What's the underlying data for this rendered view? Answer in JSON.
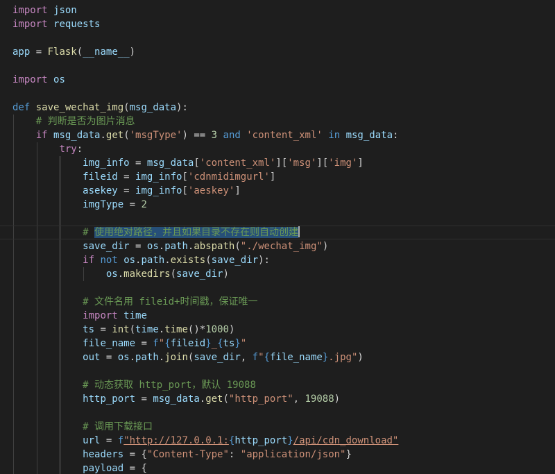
{
  "editor": {
    "lines": [
      {
        "tokens": [
          [
            "k",
            "import"
          ],
          [
            "p",
            " "
          ],
          [
            "v",
            "json"
          ]
        ]
      },
      {
        "tokens": [
          [
            "k",
            "import"
          ],
          [
            "p",
            " "
          ],
          [
            "v",
            "requests"
          ]
        ]
      },
      {
        "tokens": []
      },
      {
        "tokens": [
          [
            "v",
            "app"
          ],
          [
            "p",
            " = "
          ],
          [
            "f",
            "Flask"
          ],
          [
            "p",
            "("
          ],
          [
            "v",
            "__name__"
          ],
          [
            "p",
            ")"
          ]
        ]
      },
      {
        "tokens": []
      },
      {
        "tokens": [
          [
            "k",
            "import"
          ],
          [
            "p",
            " "
          ],
          [
            "v",
            "os"
          ]
        ]
      },
      {
        "tokens": []
      },
      {
        "tokens": [
          [
            "d",
            "def"
          ],
          [
            "p",
            " "
          ],
          [
            "f",
            "save_wechat_img"
          ],
          [
            "p",
            "("
          ],
          [
            "v",
            "msg_data"
          ],
          [
            "p",
            "):"
          ]
        ]
      },
      {
        "tokens": [
          [
            "p",
            "    "
          ],
          [
            "c",
            "# 判断是否为图片消息"
          ]
        ]
      },
      {
        "tokens": [
          [
            "p",
            "    "
          ],
          [
            "k",
            "if"
          ],
          [
            "p",
            " "
          ],
          [
            "v",
            "msg_data"
          ],
          [
            "p",
            "."
          ],
          [
            "f",
            "get"
          ],
          [
            "p",
            "("
          ],
          [
            "s",
            "'msgType'"
          ],
          [
            "p",
            ") == "
          ],
          [
            "n",
            "3"
          ],
          [
            "p",
            " "
          ],
          [
            "d",
            "and"
          ],
          [
            "p",
            " "
          ],
          [
            "s",
            "'content_xml'"
          ],
          [
            "p",
            " "
          ],
          [
            "d",
            "in"
          ],
          [
            "p",
            " "
          ],
          [
            "v",
            "msg_data"
          ],
          [
            "p",
            ":"
          ]
        ]
      },
      {
        "tokens": [
          [
            "p",
            "        "
          ],
          [
            "k",
            "try"
          ],
          [
            "p",
            ":"
          ]
        ]
      },
      {
        "tokens": [
          [
            "p",
            "            "
          ],
          [
            "v",
            "img_info"
          ],
          [
            "p",
            " = "
          ],
          [
            "v",
            "msg_data"
          ],
          [
            "p",
            "["
          ],
          [
            "s",
            "'content_xml'"
          ],
          [
            "p",
            "]["
          ],
          [
            "s",
            "'msg'"
          ],
          [
            "p",
            "]["
          ],
          [
            "s",
            "'img'"
          ],
          [
            "p",
            "]"
          ]
        ]
      },
      {
        "tokens": [
          [
            "p",
            "            "
          ],
          [
            "v",
            "fileid"
          ],
          [
            "p",
            " = "
          ],
          [
            "v",
            "img_info"
          ],
          [
            "p",
            "["
          ],
          [
            "s",
            "'cdnmidimgurl'"
          ],
          [
            "p",
            "]"
          ]
        ]
      },
      {
        "tokens": [
          [
            "p",
            "            "
          ],
          [
            "v",
            "asekey"
          ],
          [
            "p",
            " = "
          ],
          [
            "v",
            "img_info"
          ],
          [
            "p",
            "["
          ],
          [
            "s",
            "'aeskey'"
          ],
          [
            "p",
            "]"
          ]
        ]
      },
      {
        "tokens": [
          [
            "p",
            "            "
          ],
          [
            "v",
            "imgType"
          ],
          [
            "p",
            " = "
          ],
          [
            "n",
            "2"
          ]
        ]
      },
      {
        "tokens": []
      },
      {
        "tokens": [
          [
            "p",
            "            "
          ],
          [
            "c",
            "# "
          ],
          [
            "sel",
            "使用绝对路径，并且如果目录不存在则自动创建"
          ]
        ],
        "current": true
      },
      {
        "tokens": [
          [
            "p",
            "            "
          ],
          [
            "v",
            "save_dir"
          ],
          [
            "p",
            " = "
          ],
          [
            "v",
            "os"
          ],
          [
            "p",
            "."
          ],
          [
            "v",
            "path"
          ],
          [
            "p",
            "."
          ],
          [
            "f",
            "abspath"
          ],
          [
            "p",
            "("
          ],
          [
            "s",
            "\"./wechat_img\""
          ],
          [
            "p",
            ")"
          ]
        ]
      },
      {
        "tokens": [
          [
            "p",
            "            "
          ],
          [
            "k",
            "if"
          ],
          [
            "p",
            " "
          ],
          [
            "d",
            "not"
          ],
          [
            "p",
            " "
          ],
          [
            "v",
            "os"
          ],
          [
            "p",
            "."
          ],
          [
            "v",
            "path"
          ],
          [
            "p",
            "."
          ],
          [
            "f",
            "exists"
          ],
          [
            "p",
            "("
          ],
          [
            "v",
            "save_dir"
          ],
          [
            "p",
            "):"
          ]
        ]
      },
      {
        "tokens": [
          [
            "p",
            "                "
          ],
          [
            "v",
            "os"
          ],
          [
            "p",
            "."
          ],
          [
            "f",
            "makedirs"
          ],
          [
            "p",
            "("
          ],
          [
            "v",
            "save_dir"
          ],
          [
            "p",
            ")"
          ]
        ]
      },
      {
        "tokens": []
      },
      {
        "tokens": [
          [
            "p",
            "            "
          ],
          [
            "c",
            "# 文件名用 fileid+时间戳，保证唯一"
          ]
        ]
      },
      {
        "tokens": [
          [
            "p",
            "            "
          ],
          [
            "k",
            "import"
          ],
          [
            "p",
            " "
          ],
          [
            "v",
            "time"
          ]
        ]
      },
      {
        "tokens": [
          [
            "p",
            "            "
          ],
          [
            "v",
            "ts"
          ],
          [
            "p",
            " = "
          ],
          [
            "f",
            "int"
          ],
          [
            "p",
            "("
          ],
          [
            "v",
            "time"
          ],
          [
            "p",
            "."
          ],
          [
            "f",
            "time"
          ],
          [
            "p",
            "()*"
          ],
          [
            "n",
            "1000"
          ],
          [
            "p",
            ")"
          ]
        ]
      },
      {
        "tokens": [
          [
            "p",
            "            "
          ],
          [
            "v",
            "file_name"
          ],
          [
            "p",
            " = "
          ],
          [
            "d",
            "f"
          ],
          [
            "s",
            "\""
          ],
          [
            "b",
            "{"
          ],
          [
            "v",
            "fileid"
          ],
          [
            "b",
            "}"
          ],
          [
            "s",
            "_"
          ],
          [
            "b",
            "{"
          ],
          [
            "v",
            "ts"
          ],
          [
            "b",
            "}"
          ],
          [
            "s",
            "\""
          ]
        ]
      },
      {
        "tokens": [
          [
            "p",
            "            "
          ],
          [
            "v",
            "out"
          ],
          [
            "p",
            " = "
          ],
          [
            "v",
            "os"
          ],
          [
            "p",
            "."
          ],
          [
            "v",
            "path"
          ],
          [
            "p",
            "."
          ],
          [
            "f",
            "join"
          ],
          [
            "p",
            "("
          ],
          [
            "v",
            "save_dir"
          ],
          [
            "p",
            ", "
          ],
          [
            "d",
            "f"
          ],
          [
            "s",
            "\""
          ],
          [
            "b",
            "{"
          ],
          [
            "v",
            "file_name"
          ],
          [
            "b",
            "}"
          ],
          [
            "s",
            ".jpg\""
          ],
          [
            "p",
            ")"
          ]
        ]
      },
      {
        "tokens": []
      },
      {
        "tokens": [
          [
            "p",
            "            "
          ],
          [
            "c",
            "# 动态获取 http_port，默认 19088"
          ]
        ]
      },
      {
        "tokens": [
          [
            "p",
            "            "
          ],
          [
            "v",
            "http_port"
          ],
          [
            "p",
            " = "
          ],
          [
            "v",
            "msg_data"
          ],
          [
            "p",
            "."
          ],
          [
            "f",
            "get"
          ],
          [
            "p",
            "("
          ],
          [
            "s",
            "\"http_port\""
          ],
          [
            "p",
            ", "
          ],
          [
            "n",
            "19088"
          ],
          [
            "p",
            ")"
          ]
        ]
      },
      {
        "tokens": []
      },
      {
        "tokens": [
          [
            "p",
            "            "
          ],
          [
            "c",
            "# 调用下载接口"
          ]
        ]
      },
      {
        "tokens": [
          [
            "p",
            "            "
          ],
          [
            "v",
            "url"
          ],
          [
            "p",
            " = "
          ],
          [
            "d",
            "f"
          ],
          [
            "u",
            "\"http://127.0.0.1:"
          ],
          [
            "b",
            "{"
          ],
          [
            "v",
            "http_port"
          ],
          [
            "b",
            "}"
          ],
          [
            "u",
            "/api/cdn_download\""
          ]
        ]
      },
      {
        "tokens": [
          [
            "p",
            "            "
          ],
          [
            "v",
            "headers"
          ],
          [
            "p",
            " = {"
          ],
          [
            "s",
            "\"Content-Type\""
          ],
          [
            "p",
            ": "
          ],
          [
            "s",
            "\"application/json\""
          ],
          [
            "p",
            "}"
          ]
        ]
      },
      {
        "tokens": [
          [
            "p",
            "            "
          ],
          [
            "v",
            "payload"
          ],
          [
            "p",
            " = {"
          ]
        ]
      }
    ]
  }
}
